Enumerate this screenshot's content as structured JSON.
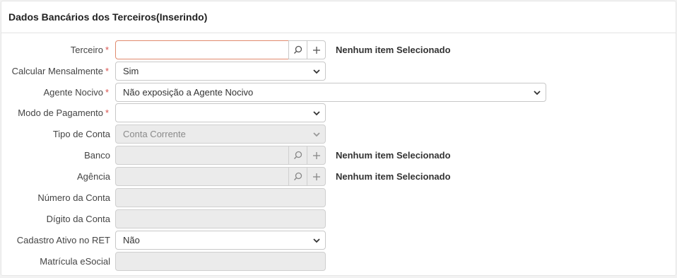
{
  "panel": {
    "title": "Dados Bancários dos Terceiros(Inserindo)"
  },
  "fields": {
    "terceiro": {
      "label": "Terceiro",
      "value": "",
      "note": "Nenhum item Selecionado"
    },
    "calcular_mensalmente": {
      "label": "Calcular Mensalmente",
      "value": "Sim"
    },
    "agente_nocivo": {
      "label": "Agente Nocivo",
      "value": "Não exposição a Agente Nocivo"
    },
    "modo_pagamento": {
      "label": "Modo de Pagamento",
      "value": ""
    },
    "tipo_conta": {
      "label": "Tipo de Conta",
      "value": "Conta Corrente"
    },
    "banco": {
      "label": "Banco",
      "value": "",
      "note": "Nenhum item Selecionado"
    },
    "agencia": {
      "label": "Agência",
      "value": "",
      "note": "Nenhum item Selecionado"
    },
    "numero_conta": {
      "label": "Número da Conta",
      "value": ""
    },
    "digito_conta": {
      "label": "Dígito da Conta",
      "value": ""
    },
    "cadastro_ret": {
      "label": "Cadastro Ativo no RET",
      "value": "Não"
    },
    "matricula_esocial": {
      "label": "Matrícula eSocial",
      "value": ""
    }
  },
  "required_marker": "*",
  "colors": {
    "required": "#d9534f",
    "error_border": "#e08a6e",
    "disabled_bg": "#ebebeb"
  }
}
